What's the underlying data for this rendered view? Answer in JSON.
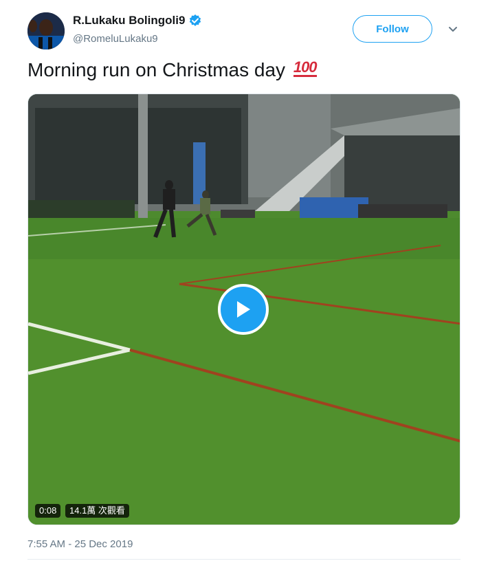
{
  "author": {
    "display_name": "R.Lukaku Bolingoli9",
    "handle": "@RomeluLukaku9",
    "verified": true,
    "avatar_icon": "profile-photo"
  },
  "actions": {
    "follow_label": "Follow",
    "menu_icon": "chevron-down-icon"
  },
  "tweet": {
    "text": "Morning run on Christmas day",
    "emoji": "100",
    "timestamp": "7:55 AM - 25 Dec 2019"
  },
  "video": {
    "duration": "0:08",
    "views": "14.1萬 次觀看",
    "play_icon": "play-icon"
  },
  "colors": {
    "accent": "#1da1f2",
    "text": "#14171a",
    "secondary": "#657786",
    "emoji": "#d62b3c"
  }
}
